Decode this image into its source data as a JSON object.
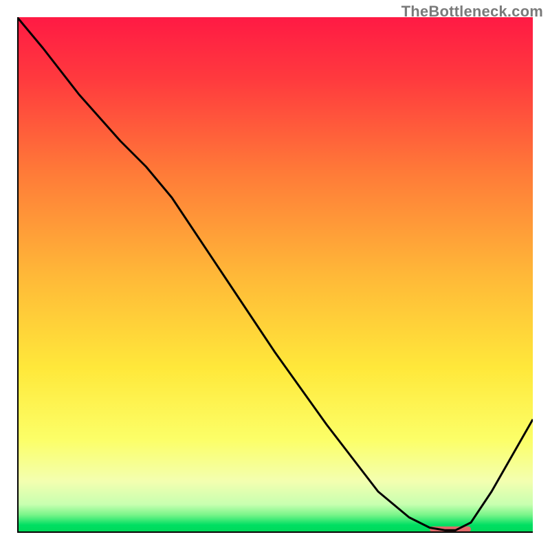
{
  "watermark": "TheBottleneck.com",
  "chart_data": {
    "type": "line",
    "title": "",
    "xlabel": "",
    "ylabel": "",
    "xlim": [
      0,
      100
    ],
    "ylim": [
      0,
      100
    ],
    "grid": false,
    "legend": false,
    "background_gradient": [
      "#ff1a44",
      "#ff6a3a",
      "#ffb33a",
      "#ffe83a",
      "#fbff7a",
      "#d6ffae",
      "#00e060"
    ],
    "curve": {
      "x": [
        0,
        5,
        12,
        20,
        25,
        30,
        40,
        50,
        60,
        70,
        76,
        80,
        83,
        85,
        88,
        92,
        100
      ],
      "y": [
        100,
        94,
        85,
        76,
        71,
        65,
        50,
        35,
        21,
        8,
        3,
        1,
        0.5,
        0.5,
        2,
        8,
        22
      ]
    },
    "marker_bar": {
      "x_start": 80,
      "x_end": 88,
      "y": 0.7,
      "color": "#e06a6a"
    },
    "note": "Axes are unlabeled in the source image; x and y are normalized 0–100. Curve values estimated from pixel positions."
  },
  "colors": {
    "curve": "#000000",
    "axis": "#000000",
    "marker": "#e06a6a"
  }
}
